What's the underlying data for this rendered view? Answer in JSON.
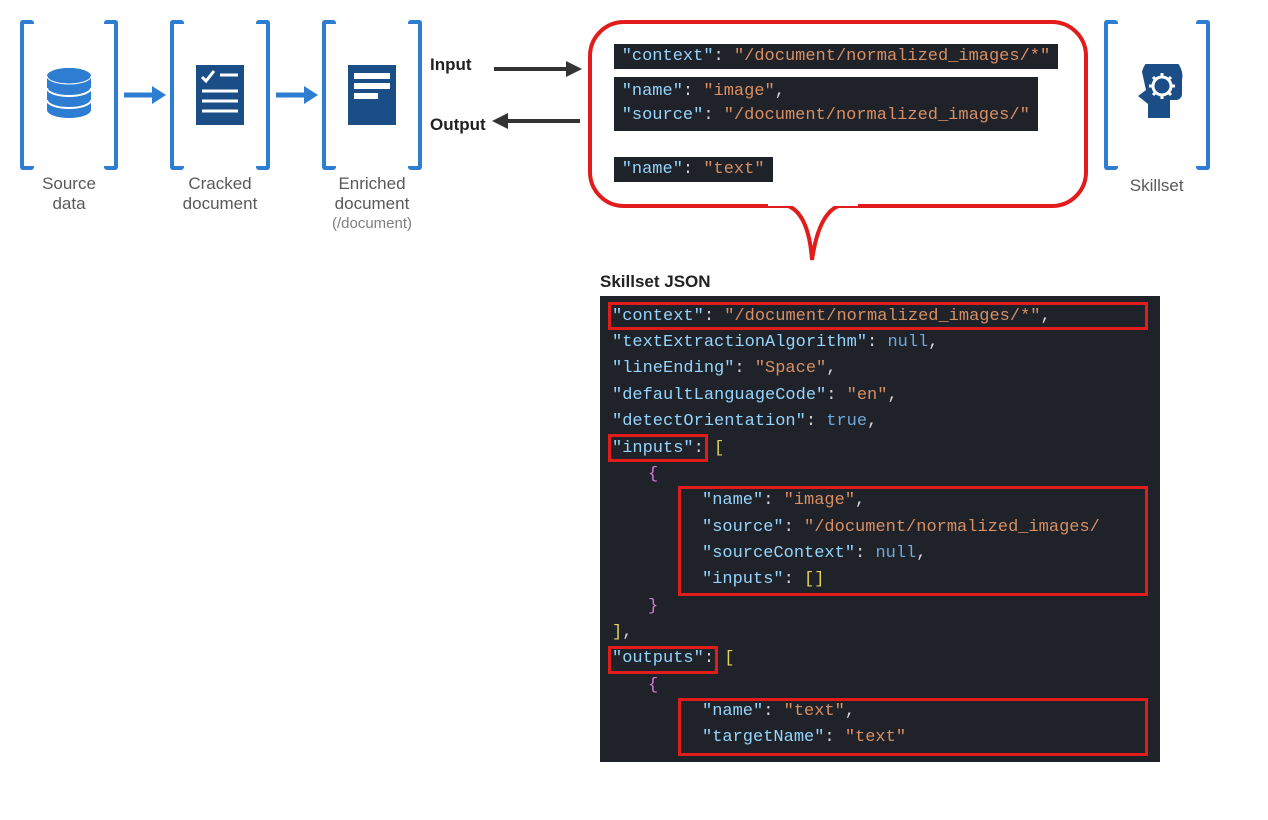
{
  "pipeline": {
    "source_label": "Source\ndata",
    "cracked_label": "Cracked\ndocument",
    "enriched_label": "Enriched\ndocument",
    "enriched_sub": "(/document)",
    "input_label": "Input",
    "output_label": "Output",
    "skillset_label": "Skillset"
  },
  "callout": {
    "line1_key": "\"context\"",
    "line1_val": "\"/document/normalized_images/*\"",
    "line2a_key": "\"name\"",
    "line2a_val": "\"image\"",
    "line2b_key": "\"source\"",
    "line2b_val": "\"/document/normalized_images/\"",
    "line3_key": "\"name\"",
    "line3_val": "\"text\""
  },
  "json_section": {
    "title": "Skillset JSON",
    "l1_key": "\"context\"",
    "l1_val": "\"/document/normalized_images/*\"",
    "l2_key": "\"textExtractionAlgorithm\"",
    "l2_val": "null",
    "l3_key": "\"lineEnding\"",
    "l3_val": "\"Space\"",
    "l4_key": "\"defaultLanguageCode\"",
    "l4_val": "\"en\"",
    "l5_key": "\"detectOrientation\"",
    "l5_val": "true",
    "l6_key": "\"inputs\"",
    "l7_key": "\"name\"",
    "l7_val": "\"image\"",
    "l8_key": "\"source\"",
    "l8_val": "\"/document/normalized_images/",
    "l9_key": "\"sourceContext\"",
    "l9_val": "null",
    "l10_key": "\"inputs\"",
    "l11_key": "\"outputs\"",
    "l12_key": "\"name\"",
    "l12_val": "\"text\"",
    "l13_key": "\"targetName\"",
    "l13_val": "\"text\""
  }
}
